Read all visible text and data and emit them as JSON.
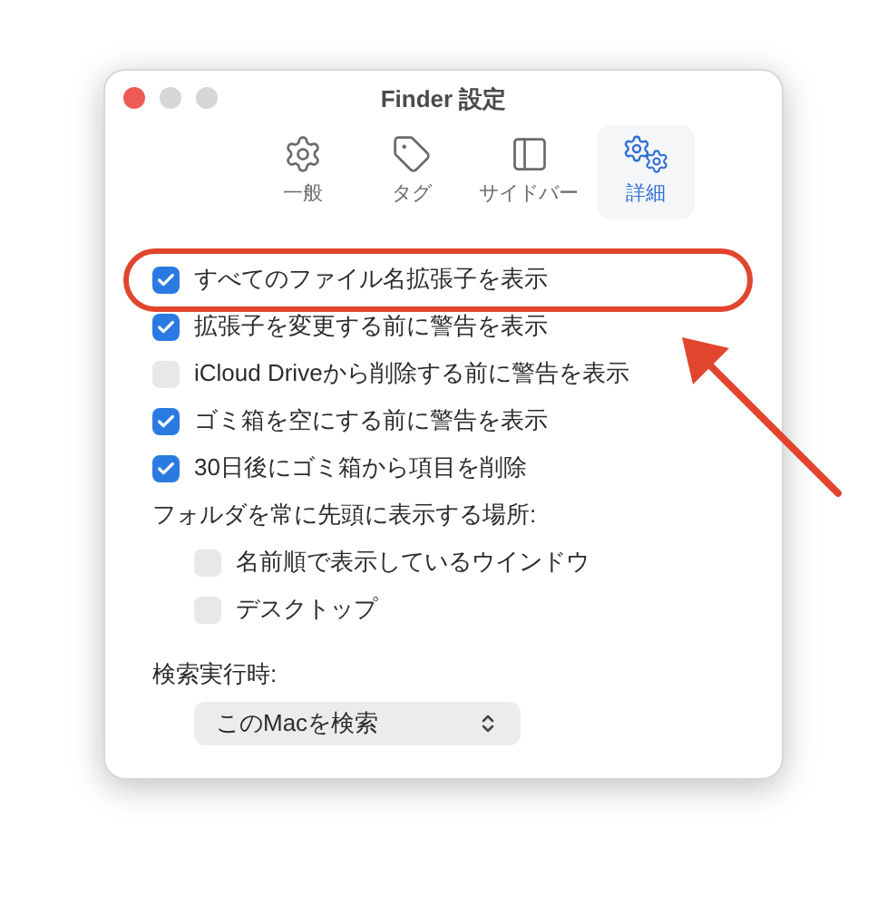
{
  "window": {
    "title": "Finder 設定"
  },
  "tabs": [
    {
      "label": "一般",
      "kind": "gear",
      "selected": false
    },
    {
      "label": "タグ",
      "kind": "tag",
      "selected": false
    },
    {
      "label": "サイドバー",
      "kind": "sidebar",
      "selected": false
    },
    {
      "label": "詳細",
      "kind": "gears",
      "selected": true
    }
  ],
  "options": [
    {
      "label": "すべてのファイル名拡張子を表示",
      "checked": true
    },
    {
      "label": "拡張子を変更する前に警告を表示",
      "checked": true
    },
    {
      "label": "iCloud Driveから削除する前に警告を表示",
      "checked": false
    },
    {
      "label": "ゴミ箱を空にする前に警告を表示",
      "checked": true
    },
    {
      "label": "30日後にゴミ箱から項目を削除",
      "checked": true
    }
  ],
  "folders_on_top": {
    "label": "フォルダを常に先頭に表示する場所:",
    "options": [
      {
        "label": "名前順で表示しているウインドウ",
        "checked": false
      },
      {
        "label": "デスクトップ",
        "checked": false
      }
    ]
  },
  "search": {
    "label": "検索実行時:",
    "value": "このMacを検索"
  }
}
